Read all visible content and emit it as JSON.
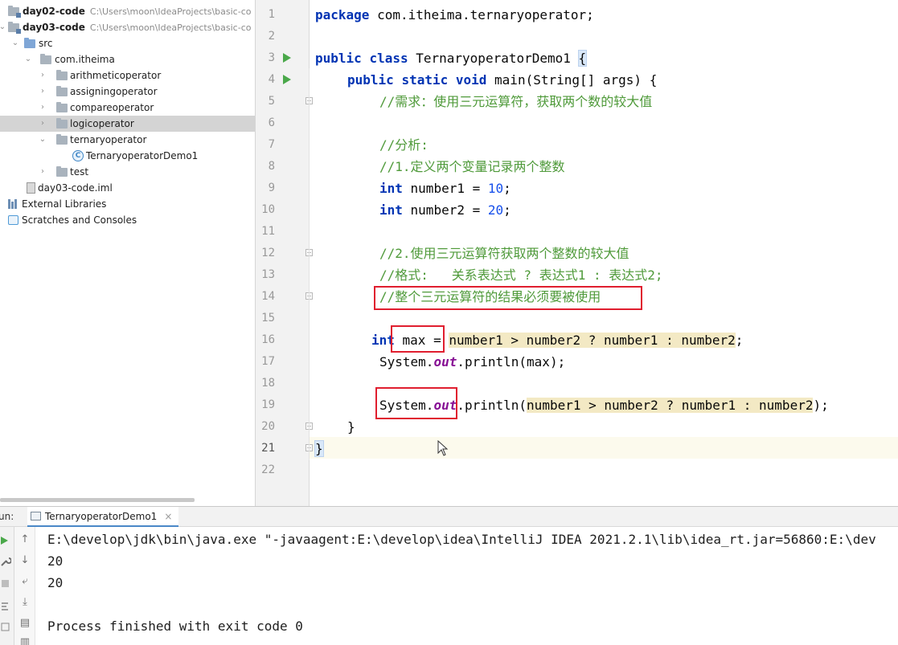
{
  "project_tree": {
    "rows": [
      {
        "name": "day02-code",
        "path": "C:\\Users\\moon\\IdeaProjects\\basic-co",
        "type": "module"
      },
      {
        "name": "day03-code",
        "path": "C:\\Users\\moon\\IdeaProjects\\basic-co",
        "type": "module"
      },
      {
        "name": "src",
        "type": "src-folder"
      },
      {
        "name": "com.itheima",
        "type": "package"
      },
      {
        "name": "arithmeticoperator",
        "type": "package"
      },
      {
        "name": "assigningoperator",
        "type": "package"
      },
      {
        "name": "compareoperator",
        "type": "package"
      },
      {
        "name": "logicoperator",
        "type": "package",
        "selected": true
      },
      {
        "name": "ternaryoperator",
        "type": "package"
      },
      {
        "name": "TernaryoperatorDemo1",
        "type": "class"
      },
      {
        "name": "test",
        "type": "package"
      },
      {
        "name": "day03-code.iml",
        "type": "file"
      },
      {
        "name": "External Libraries",
        "type": "libraries"
      },
      {
        "name": "Scratches and Consoles",
        "type": "scratches"
      }
    ]
  },
  "editor": {
    "line_numbers": [
      "1",
      "2",
      "3",
      "4",
      "5",
      "6",
      "7",
      "8",
      "9",
      "10",
      "11",
      "12",
      "13",
      "14",
      "15",
      "16",
      "17",
      "18",
      "19",
      "20",
      "21",
      "22"
    ],
    "current_line": "21",
    "code": {
      "l1_kw": "package",
      "l1_rest": " com.itheima.ternaryoperator;",
      "l3_kw1": "public",
      "l3_kw2": "class",
      "l3_name": " TernaryoperatorDemo1 ",
      "l3_brace": "{",
      "l4_kw1": "public",
      "l4_kw2": "static",
      "l4_kw3": "void",
      "l4_rest": " main(String[] args) {",
      "l5": "//需求：使用三元运算符，获取两个数的较大值",
      "l7": "//分析:",
      "l8": "//1.定义两个变量记录两个整数",
      "l9_kw": "int",
      "l9_rest": " number1 = ",
      "l9_num": "10",
      "l9_end": ";",
      "l10_kw": "int",
      "l10_rest": " number2 = ",
      "l10_num": "20",
      "l10_end": ";",
      "l12": "//2.使用三元运算符获取两个整数的较大值",
      "l13": "//格式:   关系表达式 ? 表达式1 : 表达式2;",
      "l14": "//整个三元运算符的结果必须要被使用",
      "l16_kw": "int",
      "l16_rest": " max = ",
      "l16_cond": "number1 > number2 ? number1 : number2",
      "l16_end": ";",
      "l17_a": "System.",
      "l17_out": "out",
      "l17_b": ".println(max);",
      "l19_a": "System.",
      "l19_out": "out",
      "l19_b": ".println(",
      "l19_cond": "number1 > number2 ? number1 : number2",
      "l19_end": ");",
      "l20": "}",
      "l21": "}"
    }
  },
  "run_panel": {
    "label": "un:",
    "tab_title": "TernaryoperatorDemo1",
    "tab_close": "×",
    "output": [
      "E:\\develop\\jdk\\bin\\java.exe \"-javaagent:E:\\develop\\idea\\IntelliJ IDEA 2021.2.1\\lib\\idea_rt.jar=56860:E:\\dev",
      "20",
      "20",
      "",
      "Process finished with exit code 0"
    ]
  },
  "colors": {
    "keyword": "#0033b3",
    "comment": "#4f9a3a",
    "number": "#1750eb",
    "static_field": "#871094",
    "annotation_box": "#e01e2f",
    "run_icon": "#4aa84a"
  }
}
